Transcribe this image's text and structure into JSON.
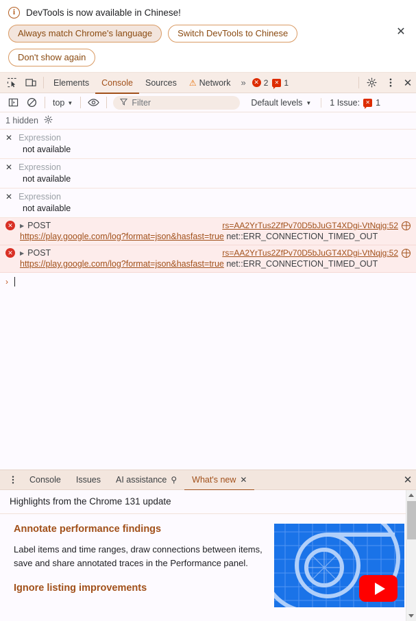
{
  "banner": {
    "icon": "info-icon",
    "message": "DevTools is now available in Chinese!",
    "buttons": [
      {
        "label": "Always match Chrome's language",
        "style": "filled"
      },
      {
        "label": "Switch DevTools to Chinese",
        "style": "outline"
      },
      {
        "label": "Don't show again",
        "style": "outline"
      }
    ],
    "close_icon": "✕"
  },
  "main_tabbar": {
    "inspect_icon": "inspect-icon",
    "device_icon": "device-toolbar-icon",
    "tabs": [
      {
        "label": "Elements",
        "active": false
      },
      {
        "label": "Console",
        "active": true
      },
      {
        "label": "Sources",
        "active": false
      },
      {
        "label": "Network",
        "active": false,
        "warning": true
      }
    ],
    "warning_glyph": "⚠",
    "more_tabs": "»",
    "error_count": "2",
    "issue_count": "1",
    "error_glyph": "✕",
    "issue_glyph": "✕",
    "settings_icon": "gear-icon",
    "more_icon": "kebab-menu-icon",
    "close_icon": "✕"
  },
  "console_toolbar": {
    "sidebar_icon": "console-sidebar-icon",
    "clear_icon": "clear-console-icon",
    "context": "top",
    "caret": "▼",
    "eye_icon": "live-expression-eye-icon",
    "filter_icon": "∇",
    "filter_placeholder": "Filter",
    "filter_value": "",
    "levels_label": "Default levels",
    "issues_label": "1 Issue:",
    "issues_count": "1"
  },
  "hidden_bar": {
    "label": "1 hidden",
    "settings_icon": "gear-icon"
  },
  "console": {
    "live_expressions": [
      {
        "close": "✕",
        "name": "Expression",
        "value": "not available"
      },
      {
        "close": "✕",
        "name": "Expression",
        "value": "not available"
      },
      {
        "close": "✕",
        "name": "Expression",
        "value": "not available"
      }
    ],
    "errors": [
      {
        "icon": "error-circle-icon",
        "icon_glyph": "✕",
        "toggle": "▶",
        "method": "POST",
        "source": "rs=AA2YrTus2ZfPv70D5bJuGT4XDgi-VtNqjg:52",
        "source_icon": "network-globe-icon",
        "url": "https://play.google.com/log?format=json&hasfast=true",
        "code": "net::ERR_CONNECTION_TIMED_OUT"
      },
      {
        "icon": "error-circle-icon",
        "icon_glyph": "✕",
        "toggle": "▶",
        "method": "POST",
        "source": "rs=AA2YrTus2ZfPv70D5bJuGT4XDgi-VtNqjg:52",
        "source_icon": "network-globe-icon",
        "url": "https://play.google.com/log?format=json&hasfast=true",
        "code": "net::ERR_CONNECTION_TIMED_OUT"
      }
    ],
    "prompt_caret": "›",
    "prompt_value": ""
  },
  "drawer": {
    "more_icon": "kebab-menu-icon",
    "tabs": [
      {
        "label": "Console",
        "active": false
      },
      {
        "label": "Issues",
        "active": false
      },
      {
        "label": "AI assistance",
        "active": false,
        "icon": "⚲"
      },
      {
        "label": "What's new",
        "active": true,
        "closable": true
      }
    ],
    "tab_close_icon": "✕",
    "drawer_close_icon": "✕",
    "whats_new": {
      "header": "Highlights from the Chrome 131 update",
      "sections": [
        {
          "heading": "Annotate performance findings",
          "body": "Label items and time ranges, draw connections between items, save and share annotated traces in the Performance panel."
        },
        {
          "heading": "Ignore listing improvements",
          "body": ""
        }
      ],
      "video_thumbnail": "chrome-devtools-video-thumbnail",
      "play_button": "youtube-play-button"
    },
    "scrollbar": {
      "up_arrow": "scroll-up-arrow",
      "down_arrow": "scroll-down-arrow"
    }
  },
  "colors": {
    "accent": "#a1501a",
    "error": "#d93025",
    "warning": "#e8710a",
    "toolbar_bg": "#f7ece6",
    "panel_bg": "#fdfaff",
    "error_row_bg": "#fdeceb",
    "thumb_blue": "#1a73e8",
    "youtube_red": "#ff0000"
  }
}
